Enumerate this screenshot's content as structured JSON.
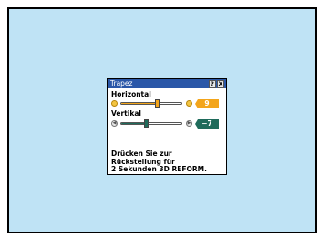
{
  "dialog": {
    "title": "Trapez",
    "help_button": "?",
    "close_button": "X"
  },
  "horizontal": {
    "label": "Horizontal",
    "value_text": "9",
    "value": 9,
    "min": -40,
    "max": 40,
    "color": "#f3a51b"
  },
  "vertikal": {
    "label": "Vertikal",
    "value_text": "−7",
    "value": -7,
    "min": -40,
    "max": 40,
    "color": "#1f6b5b"
  },
  "message": {
    "line1": "Drücken Sie zur",
    "line2": "Rückstellung für",
    "line3": "2 Sekunden 3D REFORM."
  },
  "colors": {
    "desktop": "#bfe3f5",
    "titlebar": "#2a57a8"
  }
}
